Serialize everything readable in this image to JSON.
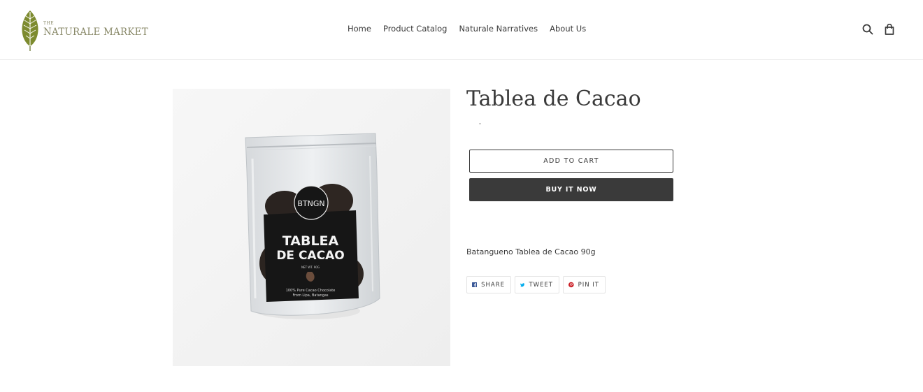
{
  "header": {
    "logo": {
      "the": "THE",
      "name": "NATURALE MARKET",
      "leaf_color": "#7d8b2f"
    },
    "nav": [
      {
        "label": "Home"
      },
      {
        "label": "Product Catalog"
      },
      {
        "label": "Naturale Narratives"
      },
      {
        "label": "About Us"
      }
    ],
    "icons": {
      "search": "search-icon",
      "cart": "shopping-bag-icon"
    }
  },
  "product": {
    "title": "Tablea de Cacao",
    "image": {
      "brand": "BTNGN",
      "line1": "TABLEA",
      "line2": "DE CACAO",
      "weight": "NET WT. 90G",
      "tagline1": "100% Pure Cacao Chocolate",
      "tagline2": "From Lipa, Batangas"
    },
    "add_to_cart": "ADD TO CART",
    "buy_now": "BUY IT NOW",
    "description": "Batangueno Tablea de Cacao 90g"
  },
  "share": {
    "facebook": "SHARE",
    "twitter": "TWEET",
    "pinterest": "PIN IT"
  },
  "colors": {
    "text": "#3a3a3a",
    "button_dark": "#3a3a3a",
    "facebook": "#3b5998",
    "twitter": "#00aced",
    "pinterest": "#cb2128"
  }
}
